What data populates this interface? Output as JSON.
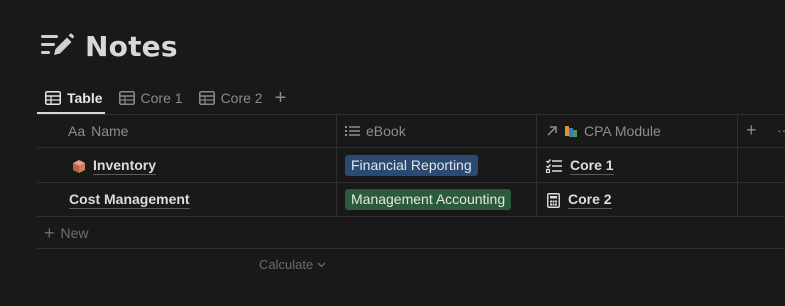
{
  "page": {
    "title": "Notes",
    "icon": "notes-edit-icon"
  },
  "tabs": [
    {
      "label": "Table",
      "icon": "table-icon",
      "active": true
    },
    {
      "label": "Core 1",
      "icon": "table-icon",
      "active": false
    },
    {
      "label": "Core 2",
      "icon": "table-icon",
      "active": false
    }
  ],
  "columns": [
    {
      "prefix": "Aa",
      "label": "Name"
    },
    {
      "label": "eBook",
      "icon": "list-icon"
    },
    {
      "label": "CPA Module",
      "icon": "relation-arrow-icon",
      "icon2": "books-icon"
    }
  ],
  "rows": [
    {
      "name": "Inventory",
      "name_icon": "box-icon",
      "ebook": "Financial Reporting",
      "ebook_color": "#2a4a73",
      "module": "Core 1",
      "module_icon": "checklist-icon"
    },
    {
      "name": "Cost Management",
      "ebook": "Management Accounting",
      "ebook_color": "#2b5b3a",
      "module": "Core 2",
      "module_icon": "calculator-icon"
    }
  ],
  "footer": {
    "new_label": "New",
    "calculate_label": "Calculate"
  },
  "colors": {
    "background": "#191919",
    "grid": "#2f2f2f",
    "tag_blue": "#2a4a73",
    "tag_green": "#2b5b3a"
  }
}
